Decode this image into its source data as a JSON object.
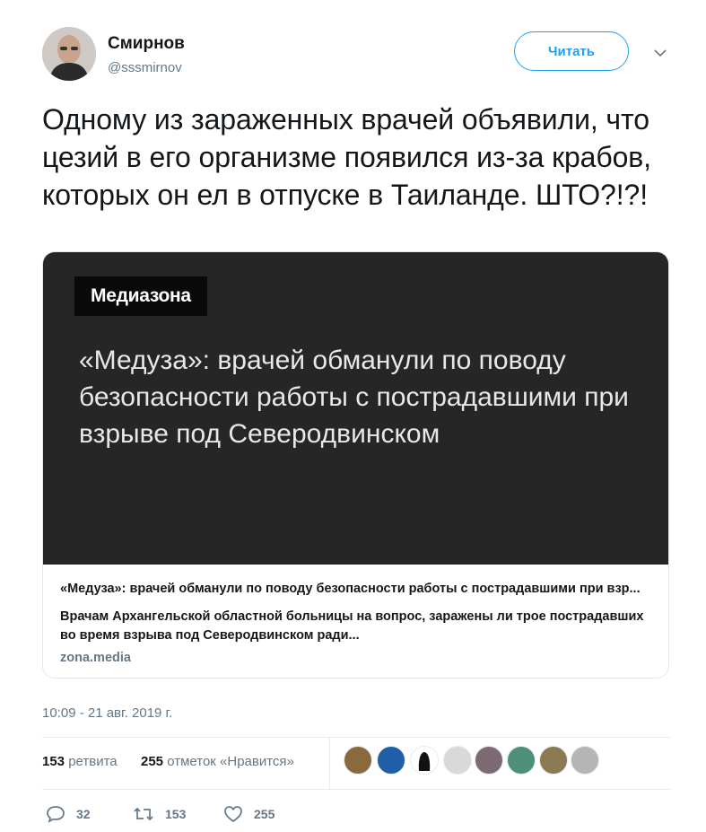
{
  "author": {
    "name": "Смирнов",
    "handle": "@sssmirnov",
    "follow_label": "Читать"
  },
  "tweet": {
    "text": "Одному из зараженных врачей объявили, что цезий в его организме появился из-за крабов, которых он ел в отпуске в Таиланде. ШТО?!?!"
  },
  "card": {
    "brand": "Медиазона",
    "image_headline": "«Медуза»: врачей обманули по поводу безопасности работы с пострадавшими при взрыве под Северодвинском",
    "title": "«Медуза»: врачей обманули по поводу безопасности работы с пострадавшими при взр...",
    "description": "Врачам Архангельской областной больницы на вопрос, заражены ли трое пострадавших во время взрыва под Северодвинском ради...",
    "domain": "zona.media"
  },
  "timestamp": "10:09 - 21 авг. 2019 г.",
  "stats": {
    "retweets_count": "153",
    "retweets_label": "ретвита",
    "likes_count": "255",
    "likes_label": "отметок «Нравится»"
  },
  "actions": {
    "reply_count": "32",
    "retweet_count": "153",
    "like_count": "255"
  },
  "colors": {
    "accent": "#1da1f2",
    "muted": "#657786",
    "card_image_bg": "#262626"
  },
  "icons": [
    "chevron-down-icon",
    "reply-icon",
    "retweet-icon",
    "heart-icon"
  ]
}
